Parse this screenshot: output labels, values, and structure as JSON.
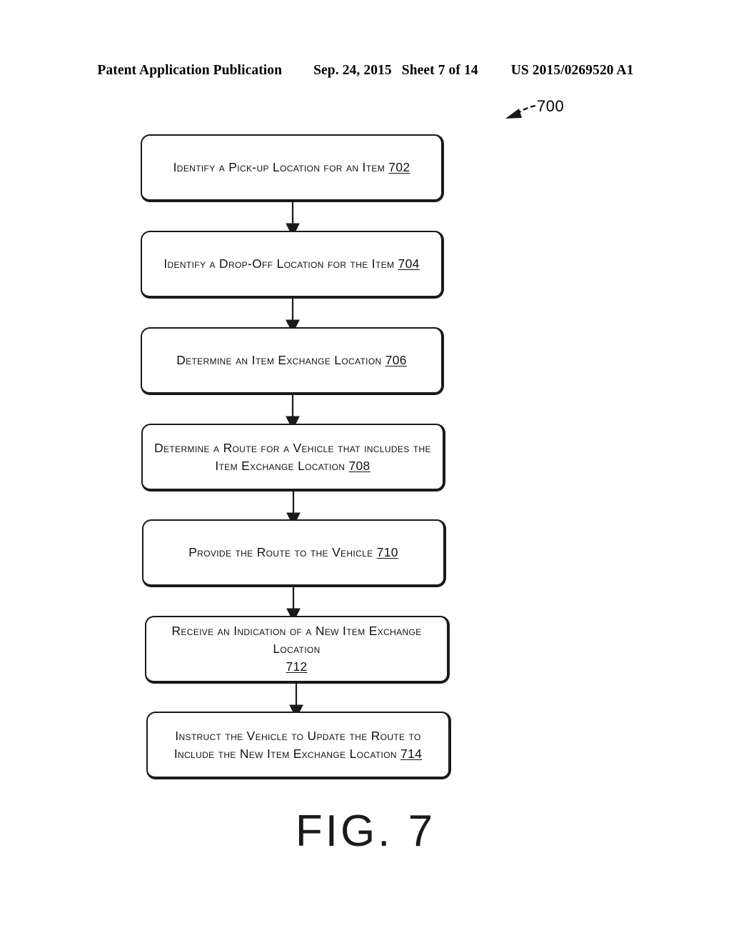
{
  "header": {
    "publication": "Patent Application Publication",
    "date": "Sep. 24, 2015",
    "sheet": "Sheet 7 of 14",
    "patent_number": "US 2015/0269520 A1"
  },
  "figure": {
    "caption": "FIG. 7",
    "reference_label": "700",
    "reference_arrow_icon": "leader-arrow-icon"
  },
  "flowchart": {
    "type": "flowchart",
    "orientation": "vertical",
    "nodes": [
      {
        "id": "702",
        "text": "Identify a Pick-up Location for an Item ",
        "ref": "702",
        "lines": 1
      },
      {
        "id": "704",
        "text": "Identify a Drop-Off Location for the Item ",
        "ref": "704",
        "lines": 1
      },
      {
        "id": "706",
        "text": "Determine an Item Exchange Location ",
        "ref": "706",
        "lines": 1
      },
      {
        "id": "708",
        "text": "Determine a Route for a Vehicle that includes the Item Exchange Location ",
        "ref": "708",
        "lines": 2
      },
      {
        "id": "710",
        "text": "Provide the Route to the Vehicle ",
        "ref": "710",
        "lines": 1
      },
      {
        "id": "712",
        "text": "Receive an Indication of a New Item Exchange Location\n",
        "ref": "712",
        "lines": 2
      },
      {
        "id": "714",
        "text": "Instruct the Vehicle to Update the Route to Include the New Item Exchange Location ",
        "ref": "714",
        "lines": 2
      }
    ],
    "edges": [
      {
        "from": "702",
        "to": "704",
        "arrow": "down-arrow-icon"
      },
      {
        "from": "704",
        "to": "706",
        "arrow": "down-arrow-icon"
      },
      {
        "from": "706",
        "to": "708",
        "arrow": "down-arrow-icon"
      },
      {
        "from": "708",
        "to": "710",
        "arrow": "down-arrow-icon"
      },
      {
        "from": "710",
        "to": "712",
        "arrow": "down-arrow-icon"
      },
      {
        "from": "712",
        "to": "714",
        "arrow": "down-arrow-icon"
      }
    ]
  },
  "colors": {
    "ink": "#1a1a1a",
    "page_background": "#ffffff"
  }
}
